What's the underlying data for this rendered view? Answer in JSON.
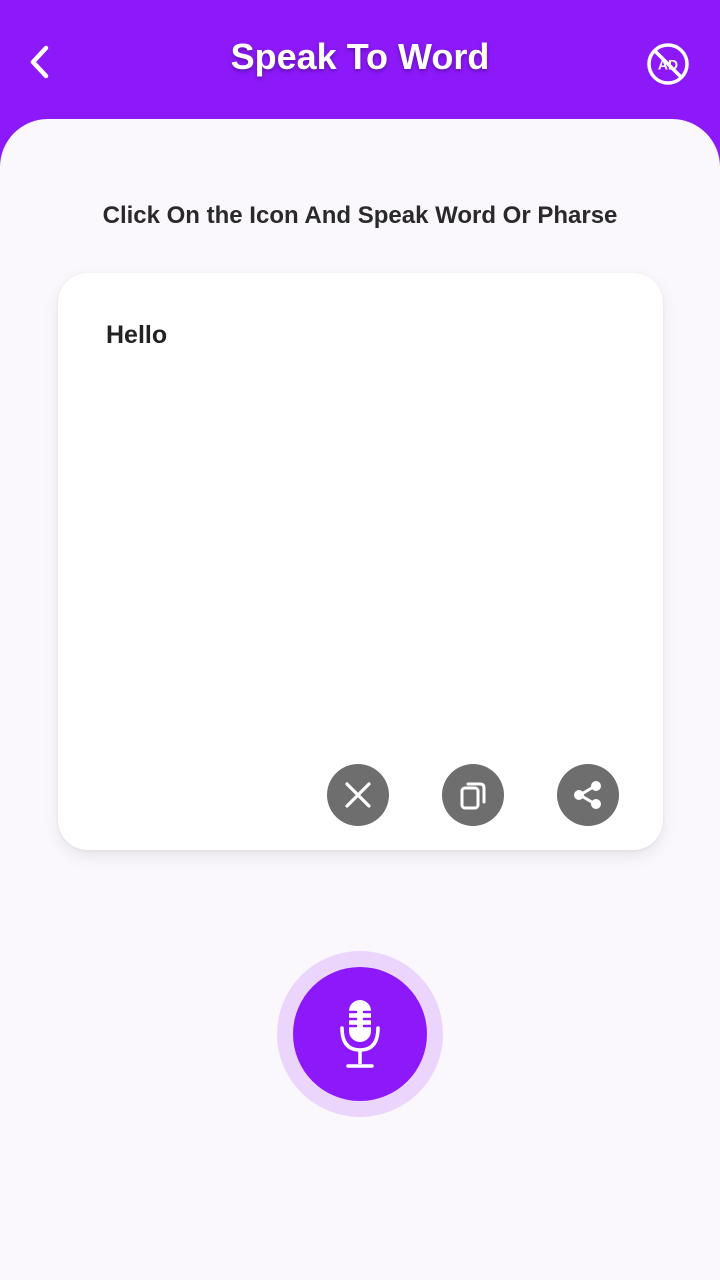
{
  "header": {
    "title": "Speak To Word",
    "background_color": "#8d19fb",
    "back_icon": "chevron-left-icon",
    "no_ads_icon": "no-ads-icon",
    "no_ads_label": "AD"
  },
  "instruction": "Click On the Icon And Speak Word Or Pharse",
  "card": {
    "recognized_text": "Hello",
    "actions": [
      {
        "name": "clear",
        "icon": "close-icon"
      },
      {
        "name": "copy",
        "icon": "copy-icon"
      },
      {
        "name": "share",
        "icon": "share-icon"
      }
    ],
    "action_button_color": "#6e6e6e"
  },
  "mic": {
    "icon": "microphone-icon",
    "button_color": "#8d19fb",
    "ring_color": "#ebd5fd"
  }
}
